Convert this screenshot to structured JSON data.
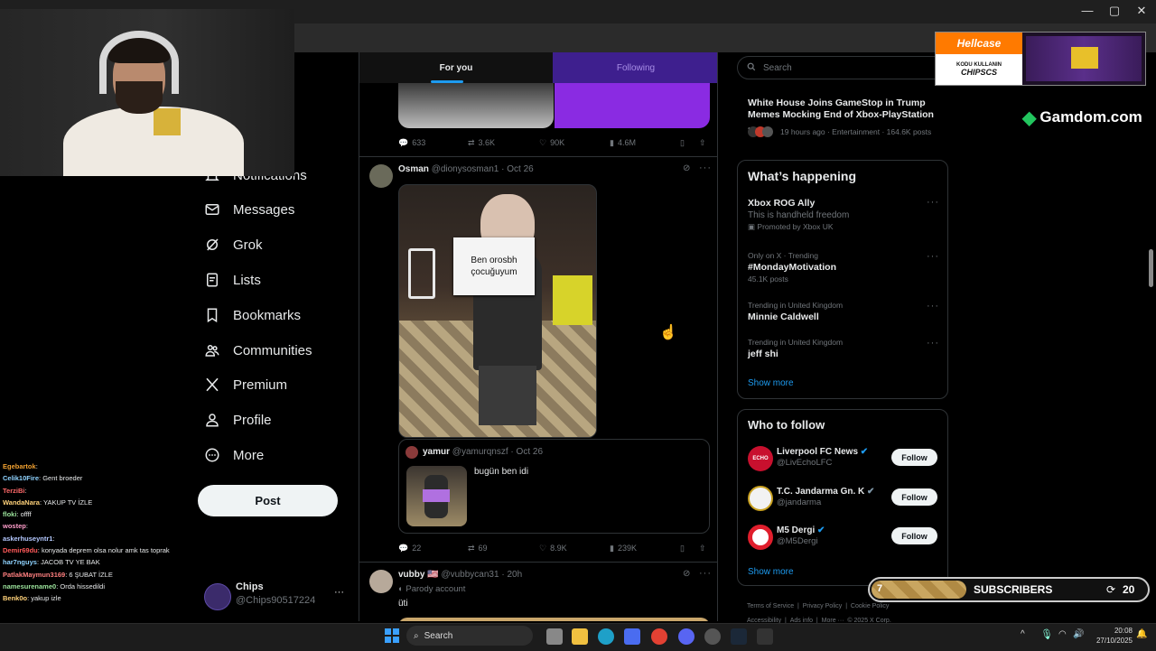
{
  "window": {
    "minimize": "—",
    "maximize": "▢",
    "close": "✕"
  },
  "nav": {
    "items": [
      {
        "label": "Notifications",
        "icon": "bell-icon"
      },
      {
        "label": "Messages",
        "icon": "mail-icon"
      },
      {
        "label": "Grok",
        "icon": "grok-icon"
      },
      {
        "label": "Lists",
        "icon": "list-icon"
      },
      {
        "label": "Bookmarks",
        "icon": "bookmark-icon"
      },
      {
        "label": "Communities",
        "icon": "people-icon"
      },
      {
        "label": "Premium",
        "icon": "x-logo-icon"
      },
      {
        "label": "Profile",
        "icon": "person-icon"
      },
      {
        "label": "More",
        "icon": "more-circle-icon"
      }
    ],
    "post_label": "Post",
    "account": {
      "name": "Chips",
      "handle": "@Chips90517224",
      "more": "···"
    }
  },
  "chat": [
    {
      "user": "Egebartok",
      "msg": "",
      "color": "#f0a030"
    },
    {
      "user": "Celik10Fire",
      "msg": "Gent broeder",
      "color": "#8fd3ff"
    },
    {
      "user": "TerziBi",
      "msg": "",
      "color": "#ff6a6a"
    },
    {
      "user": "WandaNara",
      "msg": "YAKUP TV İZLE",
      "color": "#ffd27a"
    },
    {
      "user": "floki",
      "msg": "offff",
      "color": "#9be29b"
    },
    {
      "user": "wostep",
      "msg": "",
      "color": "#ff9ecb"
    },
    {
      "user": "askerhuseyntr1",
      "msg": "",
      "color": "#b4c8ff"
    },
    {
      "user": "Demir69du",
      "msg": "konyada deprem olsa nolur amk tas toprak",
      "color": "#ff5a5a"
    },
    {
      "user": "har7nguys",
      "msg": "JACOB TV YE BAK",
      "color": "#8fd3ff"
    },
    {
      "user": "PatlakMaymun3169",
      "msg": "6 ŞUBAT İZLE",
      "color": "#ff7f7f"
    },
    {
      "user": "namesurename0",
      "msg": "Orda hissedildi",
      "color": "#9be29b"
    },
    {
      "user": "Benk0o",
      "msg": "yakup izle",
      "color": "#ffd27a"
    }
  ],
  "feed": {
    "tabs": [
      {
        "label": "For you",
        "active": true
      },
      {
        "label": "Following",
        "active": false
      }
    ],
    "tweet0_actions": {
      "replies": "633",
      "reposts": "3.6K",
      "likes": "90K",
      "views": "4.6M"
    },
    "tweet1": {
      "name": "Osman",
      "handle": "@dionysosman1",
      "date": "Oct 26",
      "sign_line1": "Ben orosbh",
      "sign_line2": "çocuğuyum",
      "quote": {
        "name": "yamur",
        "handle": "@yamurqnszf",
        "date": "Oct 26",
        "text": "bugün ben idi"
      },
      "actions": {
        "replies": "22",
        "reposts": "69",
        "likes": "8.9K",
        "views": "239K"
      }
    },
    "tweet2": {
      "name": "vubby",
      "flag": "🇺🇸",
      "handle": "@vubbycan31",
      "date": "20h",
      "badge": "Parody account",
      "text": "üti"
    }
  },
  "right": {
    "search_placeholder": "Search",
    "news": {
      "title": "White House Joins GameStop in Trump Memes Mocking End of Xbox-PlayStation ...",
      "meta": "19 hours ago · Entertainment · 164.6K posts"
    },
    "happening": {
      "title": "What’s happening",
      "items": [
        {
          "title": "Xbox ROG Ally",
          "sub": "This is handheld freedom",
          "meta": "Promoted by Xbox UK"
        },
        {
          "context": "Only on X · Trending",
          "title": "#MondayMotivation",
          "meta": "45.1K posts"
        },
        {
          "context": "Trending in United Kingdom",
          "title": "Minnie Caldwell"
        },
        {
          "context": "Trending in United Kingdom",
          "title": "jeff shi"
        }
      ],
      "show_more": "Show more"
    },
    "follow": {
      "title": "Who to follow",
      "items": [
        {
          "name": "Liverpool FC News",
          "handle": "@LivEchoLFC",
          "button": "Follow",
          "avatar_text": "ECHO"
        },
        {
          "name": "T.C. Jandarma Gn. K",
          "handle": "@jandarma",
          "button": "Follow",
          "avatar_text": ""
        },
        {
          "name": "M5 Dergi",
          "handle": "@M5Dergi",
          "button": "Follow",
          "avatar_text": ""
        }
      ],
      "show_more": "Show more"
    },
    "footer": [
      "Terms of Service",
      "Privacy Policy",
      "Cookie Policy",
      "Accessibility",
      "Ads info",
      "More ···",
      "© 2025 X Corp."
    ]
  },
  "overlays": {
    "hellcase": {
      "brand": "Hellcase",
      "line1": "KODU KULLANIN",
      "code": "CHIPSCS"
    },
    "gamdom": "Gamdom.com",
    "subs": {
      "count": "7",
      "label": "SUBSCRIBERS",
      "goal": "20"
    }
  },
  "taskbar": {
    "search": "Search",
    "time": "20:08",
    "date": "27/10/2025"
  }
}
